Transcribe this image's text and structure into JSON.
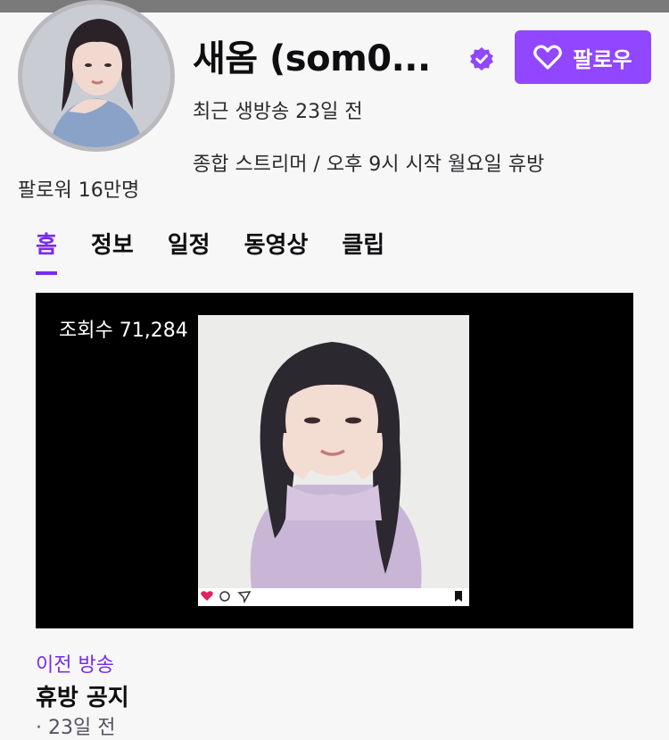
{
  "channel": {
    "name": "새옴 (som0...",
    "last_live": "최근 생방송 23일 전",
    "description": "종합 스트리머 / 오후 9시 시작 월요일 휴방",
    "followers": "팔로워 16만명",
    "verified_icon": "verified-badge-icon",
    "avatar_icon": "avatar-photo"
  },
  "follow_button": {
    "label": "팔로우",
    "icon": "heart-icon",
    "color": "#9147ff"
  },
  "tabs": [
    {
      "label": "홈",
      "active": true
    },
    {
      "label": "정보",
      "active": false
    },
    {
      "label": "일정",
      "active": false
    },
    {
      "label": "동영상",
      "active": false
    },
    {
      "label": "클립",
      "active": false
    }
  ],
  "video": {
    "view_count": "조회수 71,284",
    "category": "이전 방송",
    "title": "휴방 공지",
    "date": "· 23일 전"
  },
  "colors": {
    "accent": "#772ce8",
    "background": "#f7f7f8"
  }
}
